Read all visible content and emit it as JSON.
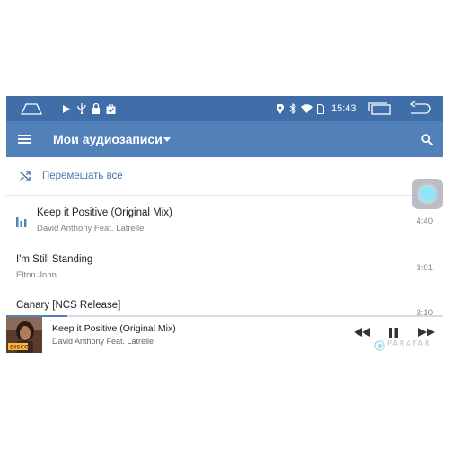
{
  "status_bar": {
    "time": "15:43",
    "icons": [
      "home-icon",
      "play-icon",
      "usb-icon",
      "lock-icon",
      "bag-icon",
      "location-icon",
      "bluetooth-icon",
      "wifi-icon",
      "sim-icon",
      "recent-apps-icon",
      "back-icon"
    ]
  },
  "app_bar": {
    "title": "Мои аудиозаписи",
    "icons": [
      "menu-icon",
      "dropdown-icon",
      "search-icon"
    ]
  },
  "shuffle": {
    "label": "Перемешать все",
    "icon": "shuffle-icon"
  },
  "tracks": [
    {
      "title": "Keep it Positive (Original Mix)",
      "artist": "David Anthony Feat. Latrelle",
      "duration": "4:40",
      "playing": true
    },
    {
      "title": "I'm Still Standing",
      "artist": "Elton John",
      "duration": "3:01",
      "playing": false
    },
    {
      "title": "Canary [NCS Release]",
      "artist": "",
      "duration": "3:10",
      "playing": false
    }
  ],
  "player": {
    "title": "Keep it Positive (Original Mix)",
    "artist": "David Anthony Feat. Latrelle",
    "cover_text": "DISCO",
    "progress": 0.14,
    "controls": [
      "rewind-icon",
      "pause-icon",
      "fast-forward-icon"
    ]
  },
  "watermark": "PARAFAR",
  "colors": {
    "status_bar": "#3f6ea8",
    "app_bar": "#5181b8",
    "accent": "#4a76a8",
    "floating_button_glow": "#8ee6f8"
  }
}
